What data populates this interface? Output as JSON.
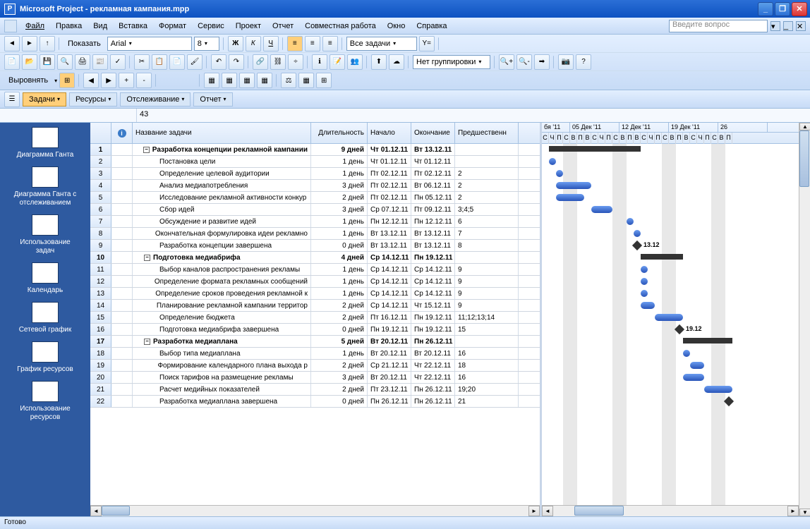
{
  "app_name": "Microsoft Project",
  "doc_name": "рекламная кампания.mpp",
  "title_full": "Microsoft Project - рекламная кампания.mpp",
  "menu": [
    "Файл",
    "Правка",
    "Вид",
    "Вставка",
    "Формат",
    "Сервис",
    "Проект",
    "Отчет",
    "Совместная работа",
    "Окно",
    "Справка"
  ],
  "question_placeholder": "Введите вопрос",
  "toolbar": {
    "show_label": "Показать",
    "font_name": "Arial",
    "font_size": "8",
    "filter": "Все задачи",
    "group": "Нет группировки",
    "align_label": "Выровнять"
  },
  "view_tabs": [
    "Задачи",
    "Ресурсы",
    "Отслеживание",
    "Отчет"
  ],
  "active_view_tab": 0,
  "formula_value": "43",
  "sidebar": [
    "Диаграмма Ганта",
    "Диаграмма Ганта с\nотслеживанием",
    "Использование\nзадач",
    "Календарь",
    "Сетевой график",
    "График ресурсов",
    "Использование\nресурсов"
  ],
  "columns": {
    "name": "Название задачи",
    "duration": "Длительность",
    "start": "Начало",
    "end": "Окончание",
    "pred": "Предшественн"
  },
  "gantt_header": {
    "weeks": [
      "бя '11",
      "05 Дек '11",
      "12 Дек '11",
      "19 Дек '11",
      "26"
    ],
    "days": "СЧПСВПВСЧПСВПВСЧПСВПВСЧПСВП"
  },
  "milestone_labels": {
    "r9": "13.12",
    "r16": "19.12"
  },
  "rows": [
    {
      "n": 1,
      "lvl": 0,
      "sum": true,
      "name": "Разработка концепции рекламной кампании",
      "dur": "9 дней",
      "start": "Чт 01.12.11",
      "end": "Вт 13.12.11",
      "pred": ""
    },
    {
      "n": 2,
      "lvl": 1,
      "name": "Постановка цели",
      "dur": "1 день",
      "start": "Чт 01.12.11",
      "end": "Чт 01.12.11",
      "pred": ""
    },
    {
      "n": 3,
      "lvl": 1,
      "name": "Определение целевой аудитории",
      "dur": "1 день",
      "start": "Пт 02.12.11",
      "end": "Пт 02.12.11",
      "pred": "2"
    },
    {
      "n": 4,
      "lvl": 1,
      "name": "Анализ медиапотребления",
      "dur": "3 дней",
      "start": "Пт 02.12.11",
      "end": "Вт 06.12.11",
      "pred": "2"
    },
    {
      "n": 5,
      "lvl": 1,
      "name": "Исследование рекламной активности конкур",
      "dur": "2 дней",
      "start": "Пт 02.12.11",
      "end": "Пн 05.12.11",
      "pred": "2"
    },
    {
      "n": 6,
      "lvl": 1,
      "name": "Сбор идей",
      "dur": "3 дней",
      "start": "Ср 07.12.11",
      "end": "Пт 09.12.11",
      "pred": "3;4;5"
    },
    {
      "n": 7,
      "lvl": 1,
      "name": "Обсуждение и развитие идей",
      "dur": "1 день",
      "start": "Пн 12.12.11",
      "end": "Пн 12.12.11",
      "pred": "6"
    },
    {
      "n": 8,
      "lvl": 1,
      "name": "Окончательная формулировка идеи рекламно",
      "dur": "1 день",
      "start": "Вт 13.12.11",
      "end": "Вт 13.12.11",
      "pred": "7"
    },
    {
      "n": 9,
      "lvl": 1,
      "name": "Разработка концепции завершена",
      "dur": "0 дней",
      "start": "Вт 13.12.11",
      "end": "Вт 13.12.11",
      "pred": "8"
    },
    {
      "n": 10,
      "lvl": 0,
      "sum": true,
      "name": "Подготовка медиабрифа",
      "dur": "4 дней",
      "start": "Ср 14.12.11",
      "end": "Пн 19.12.11",
      "pred": ""
    },
    {
      "n": 11,
      "lvl": 1,
      "name": "Выбор каналов распространения рекламы",
      "dur": "1 день",
      "start": "Ср 14.12.11",
      "end": "Ср 14.12.11",
      "pred": "9"
    },
    {
      "n": 12,
      "lvl": 1,
      "name": "Определение формата рекламных сообщений",
      "dur": "1 день",
      "start": "Ср 14.12.11",
      "end": "Ср 14.12.11",
      "pred": "9"
    },
    {
      "n": 13,
      "lvl": 1,
      "name": "Определение сроков проведения рекламной к",
      "dur": "1 день",
      "start": "Ср 14.12.11",
      "end": "Ср 14.12.11",
      "pred": "9"
    },
    {
      "n": 14,
      "lvl": 1,
      "name": "Планирование рекламной кампании территор",
      "dur": "2 дней",
      "start": "Ср 14.12.11",
      "end": "Чт 15.12.11",
      "pred": "9"
    },
    {
      "n": 15,
      "lvl": 1,
      "name": "Определение бюджета",
      "dur": "2 дней",
      "start": "Пт 16.12.11",
      "end": "Пн 19.12.11",
      "pred": "11;12;13;14"
    },
    {
      "n": 16,
      "lvl": 1,
      "name": "Подготовка медиабрифа завершена",
      "dur": "0 дней",
      "start": "Пн 19.12.11",
      "end": "Пн 19.12.11",
      "pred": "15"
    },
    {
      "n": 17,
      "lvl": 0,
      "sum": true,
      "name": "Разработка медиаплана",
      "dur": "5 дней",
      "start": "Вт 20.12.11",
      "end": "Пн 26.12.11",
      "pred": ""
    },
    {
      "n": 18,
      "lvl": 1,
      "name": "Выбор типа медиаплана",
      "dur": "1 день",
      "start": "Вт 20.12.11",
      "end": "Вт 20.12.11",
      "pred": "16"
    },
    {
      "n": 19,
      "lvl": 1,
      "name": "Формирование календарного плана выхода р",
      "dur": "2 дней",
      "start": "Ср 21.12.11",
      "end": "Чт 22.12.11",
      "pred": "18"
    },
    {
      "n": 20,
      "lvl": 1,
      "name": "Поиск тарифов на размещение рекламы",
      "dur": "3 дней",
      "start": "Вт 20.12.11",
      "end": "Чт 22.12.11",
      "pred": "16"
    },
    {
      "n": 21,
      "lvl": 1,
      "name": "Расчет медийных показателей",
      "dur": "2 дней",
      "start": "Пт 23.12.11",
      "end": "Пн 26.12.11",
      "pred": "19;20"
    },
    {
      "n": 22,
      "lvl": 1,
      "name": "Разработка медиаплана завершена",
      "dur": "0 дней",
      "start": "Пн 26.12.11",
      "end": "Пн 26.12.11",
      "pred": "21"
    }
  ],
  "status": "Готово",
  "chart_data": {
    "type": "gantt",
    "time_unit": "days",
    "visible_range": [
      "2011-11-30",
      "2011-12-27"
    ],
    "weeks": [
      "2011-12-05",
      "2011-12-12",
      "2011-12-19",
      "2011-12-26"
    ],
    "tasks": [
      {
        "id": 1,
        "type": "summary",
        "start": "2011-12-01",
        "end": "2011-12-13"
      },
      {
        "id": 2,
        "type": "bar",
        "start": "2011-12-01",
        "end": "2011-12-01"
      },
      {
        "id": 3,
        "type": "bar",
        "start": "2011-12-02",
        "end": "2011-12-02"
      },
      {
        "id": 4,
        "type": "bar",
        "start": "2011-12-02",
        "end": "2011-12-06"
      },
      {
        "id": 5,
        "type": "bar",
        "start": "2011-12-02",
        "end": "2011-12-05"
      },
      {
        "id": 6,
        "type": "bar",
        "start": "2011-12-07",
        "end": "2011-12-09"
      },
      {
        "id": 7,
        "type": "bar",
        "start": "2011-12-12",
        "end": "2011-12-12"
      },
      {
        "id": 8,
        "type": "bar",
        "start": "2011-12-13",
        "end": "2011-12-13"
      },
      {
        "id": 9,
        "type": "milestone",
        "date": "2011-12-13",
        "label": "13.12"
      },
      {
        "id": 10,
        "type": "summary",
        "start": "2011-12-14",
        "end": "2011-12-19"
      },
      {
        "id": 11,
        "type": "bar",
        "start": "2011-12-14",
        "end": "2011-12-14"
      },
      {
        "id": 12,
        "type": "bar",
        "start": "2011-12-14",
        "end": "2011-12-14"
      },
      {
        "id": 13,
        "type": "bar",
        "start": "2011-12-14",
        "end": "2011-12-14"
      },
      {
        "id": 14,
        "type": "bar",
        "start": "2011-12-14",
        "end": "2011-12-15"
      },
      {
        "id": 15,
        "type": "bar",
        "start": "2011-12-16",
        "end": "2011-12-19"
      },
      {
        "id": 16,
        "type": "milestone",
        "date": "2011-12-19",
        "label": "19.12"
      },
      {
        "id": 17,
        "type": "summary",
        "start": "2011-12-20",
        "end": "2011-12-26"
      },
      {
        "id": 18,
        "type": "bar",
        "start": "2011-12-20",
        "end": "2011-12-20"
      },
      {
        "id": 19,
        "type": "bar",
        "start": "2011-12-21",
        "end": "2011-12-22"
      },
      {
        "id": 20,
        "type": "bar",
        "start": "2011-12-20",
        "end": "2011-12-22"
      },
      {
        "id": 21,
        "type": "bar",
        "start": "2011-12-23",
        "end": "2011-12-26"
      },
      {
        "id": 22,
        "type": "milestone",
        "date": "2011-12-26"
      }
    ]
  }
}
